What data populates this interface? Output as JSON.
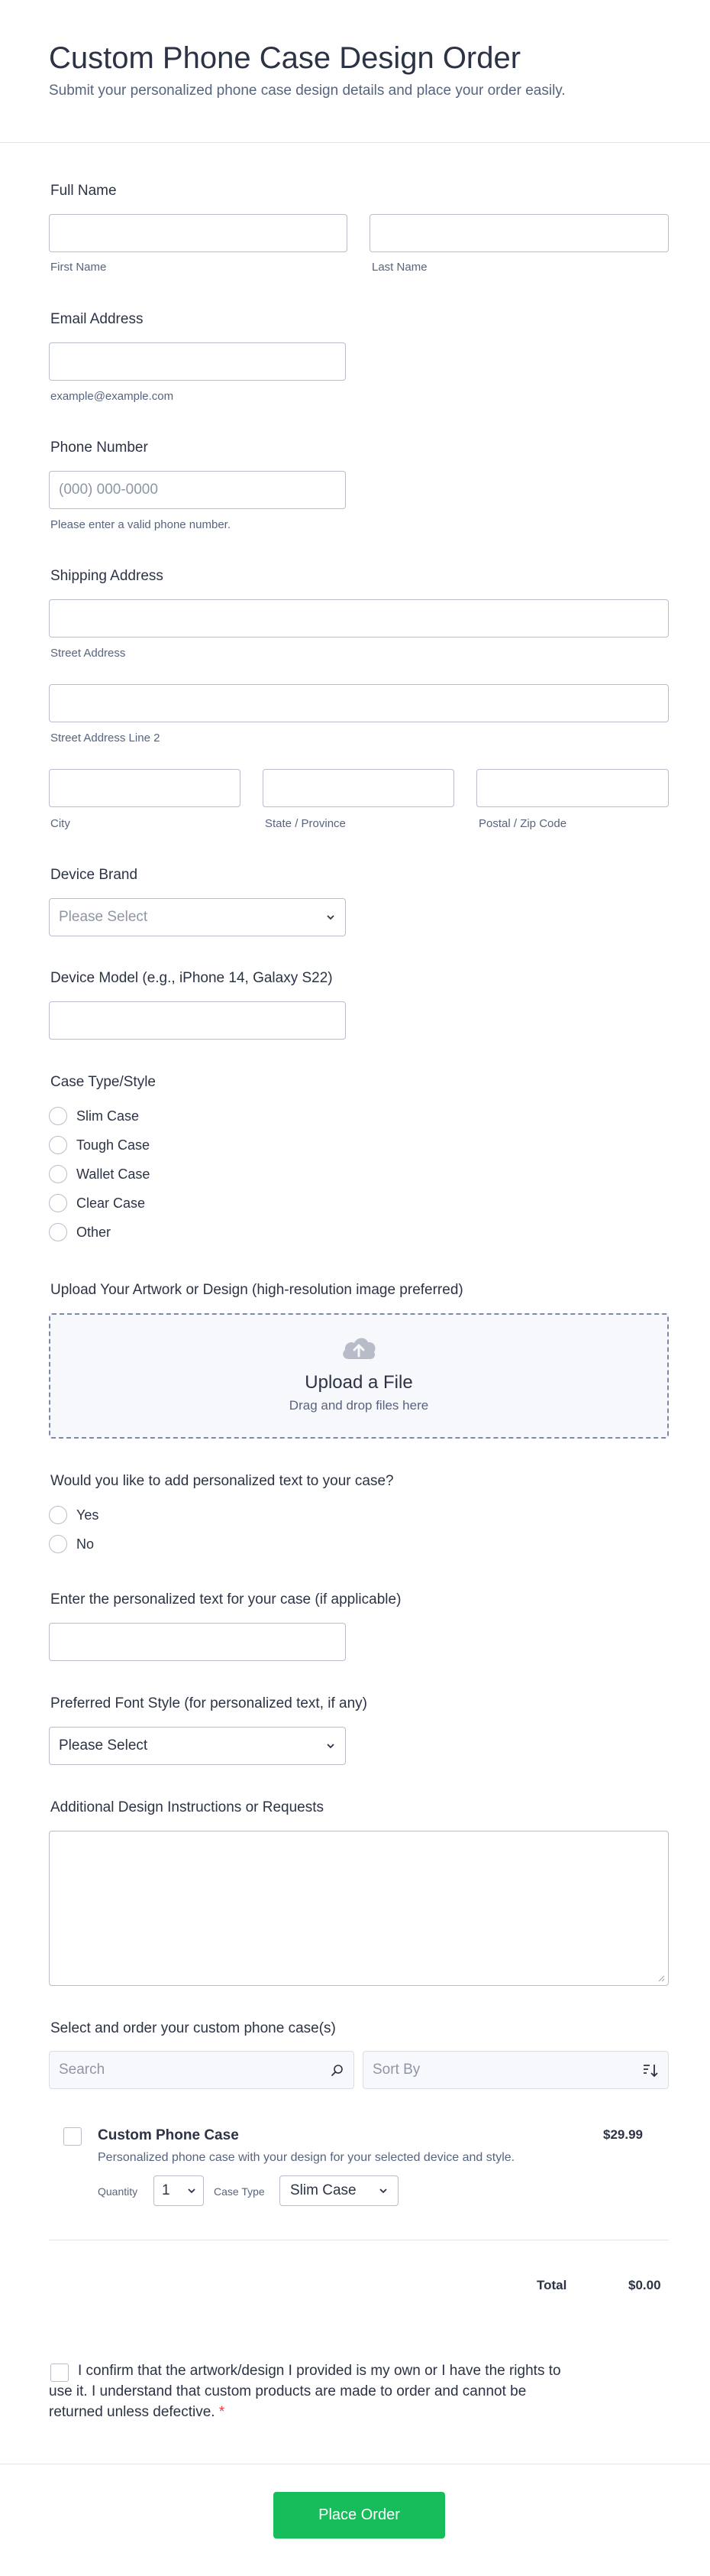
{
  "header": {
    "title": "Custom Phone Case Design Order",
    "subtitle": "Submit your personalized phone case design details and place your order easily."
  },
  "full_name": {
    "label": "Full Name",
    "first_sublabel": "First Name",
    "last_sublabel": "Last Name"
  },
  "email": {
    "label": "Email Address",
    "sublabel": "example@example.com"
  },
  "phone": {
    "label": "Phone Number",
    "placeholder": "(000) 000-0000",
    "sublabel": "Please enter a valid phone number."
  },
  "address": {
    "label": "Shipping Address",
    "street_sublabel": "Street Address",
    "street2_sublabel": "Street Address Line 2",
    "city_sublabel": "City",
    "state_sublabel": "State / Province",
    "zip_sublabel": "Postal / Zip Code"
  },
  "device_brand": {
    "label": "Device Brand",
    "placeholder": "Please Select"
  },
  "device_model": {
    "label": "Device Model (e.g., iPhone 14, Galaxy S22)"
  },
  "case_type": {
    "label": "Case Type/Style",
    "options": [
      "Slim Case",
      "Tough Case",
      "Wallet Case",
      "Clear Case",
      "Other"
    ]
  },
  "upload": {
    "label": "Upload Your Artwork or Design (high-resolution image preferred)",
    "title": "Upload a File",
    "subtitle": "Drag and drop files here",
    "icon": "cloud-upload-icon"
  },
  "personalized_text_question": {
    "label": "Would you like to add personalized text to your case?",
    "options": [
      "Yes",
      "No"
    ]
  },
  "personalized_text": {
    "label": "Enter the personalized text for your case (if applicable)"
  },
  "font_style": {
    "label": "Preferred Font Style (for personalized text, if any)",
    "selected": "Please Select"
  },
  "instructions": {
    "label": "Additional Design Instructions or Requests"
  },
  "products": {
    "label": "Select and order your custom phone case(s)",
    "search_placeholder": "Search",
    "sort_placeholder": "Sort By",
    "items": [
      {
        "name": "Custom Phone Case",
        "description": "Personalized phone case with your design for your selected device and style.",
        "price": "$29.99",
        "quantity_label": "Quantity",
        "quantity": "1",
        "case_type_label": "Case Type",
        "case_type": "Slim Case"
      }
    ],
    "total_label": "Total",
    "total_value": "$0.00"
  },
  "consent": {
    "text": "I confirm that the artwork/design I provided is my own or I have the rights to use it. I understand that custom products are made to order and cannot be returned unless defective.",
    "required_mark": "*"
  },
  "submit": {
    "label": "Place Order",
    "color": "#18bd5b"
  }
}
